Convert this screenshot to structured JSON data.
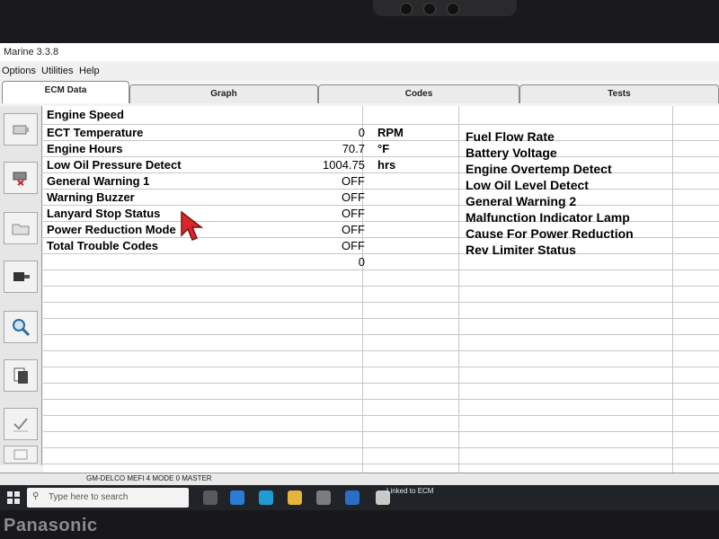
{
  "app": {
    "title": "Marine 3.3.8",
    "menu": [
      "Options",
      "Utilities",
      "Help"
    ],
    "tabs": [
      "ECM Data",
      "Graph",
      "Codes",
      "Tests"
    ],
    "active_tab": "ECM Data"
  },
  "sidebar": {
    "icons": [
      "engine-icon",
      "flag-icon",
      "folder-icon",
      "gearbox-icon",
      "magnifier-icon",
      "pages-icon",
      "checklist-icon",
      "edit-icon"
    ]
  },
  "ecm": {
    "header": "Engine Speed",
    "rows": [
      {
        "label": "ECT Temperature",
        "value": "0",
        "unit": "RPM",
        "right": "Fuel Flow Rate"
      },
      {
        "label": "Engine Hours",
        "value": "70.7",
        "unit": "°F",
        "right": "Battery Voltage"
      },
      {
        "label": "Low Oil Pressure Detect",
        "value": "1004.75",
        "unit": "hrs",
        "right": "Engine Overtemp Detect"
      },
      {
        "label": "General Warning 1",
        "value": "OFF",
        "unit": "",
        "right": "Low Oil Level Detect"
      },
      {
        "label": "Warning Buzzer",
        "value": "OFF",
        "unit": "",
        "right": "General Warning 2"
      },
      {
        "label": "Lanyard Stop Status",
        "value": "OFF",
        "unit": "",
        "right": "Malfunction Indicator Lamp"
      },
      {
        "label": "Power Reduction Mode",
        "value": "OFF",
        "unit": "",
        "right": "Cause For Power Reduction"
      },
      {
        "label": "Total Trouble Codes",
        "value": "OFF",
        "unit": "",
        "right": "Rev Limiter Status"
      },
      {
        "label": "",
        "value": "0",
        "unit": "",
        "right": ""
      }
    ]
  },
  "status": {
    "engine_profile": "GM-DELCO MEFI 4 MODE 0 MASTER",
    "connection": "Linked to ECM"
  },
  "taskbar": {
    "search_placeholder": "Type here to search"
  },
  "bezel": {
    "brand": "Panasonic"
  },
  "colors": {
    "cursor": "#d8282b",
    "taskbar": "#202428",
    "grid_line": "#c6c6c6"
  }
}
